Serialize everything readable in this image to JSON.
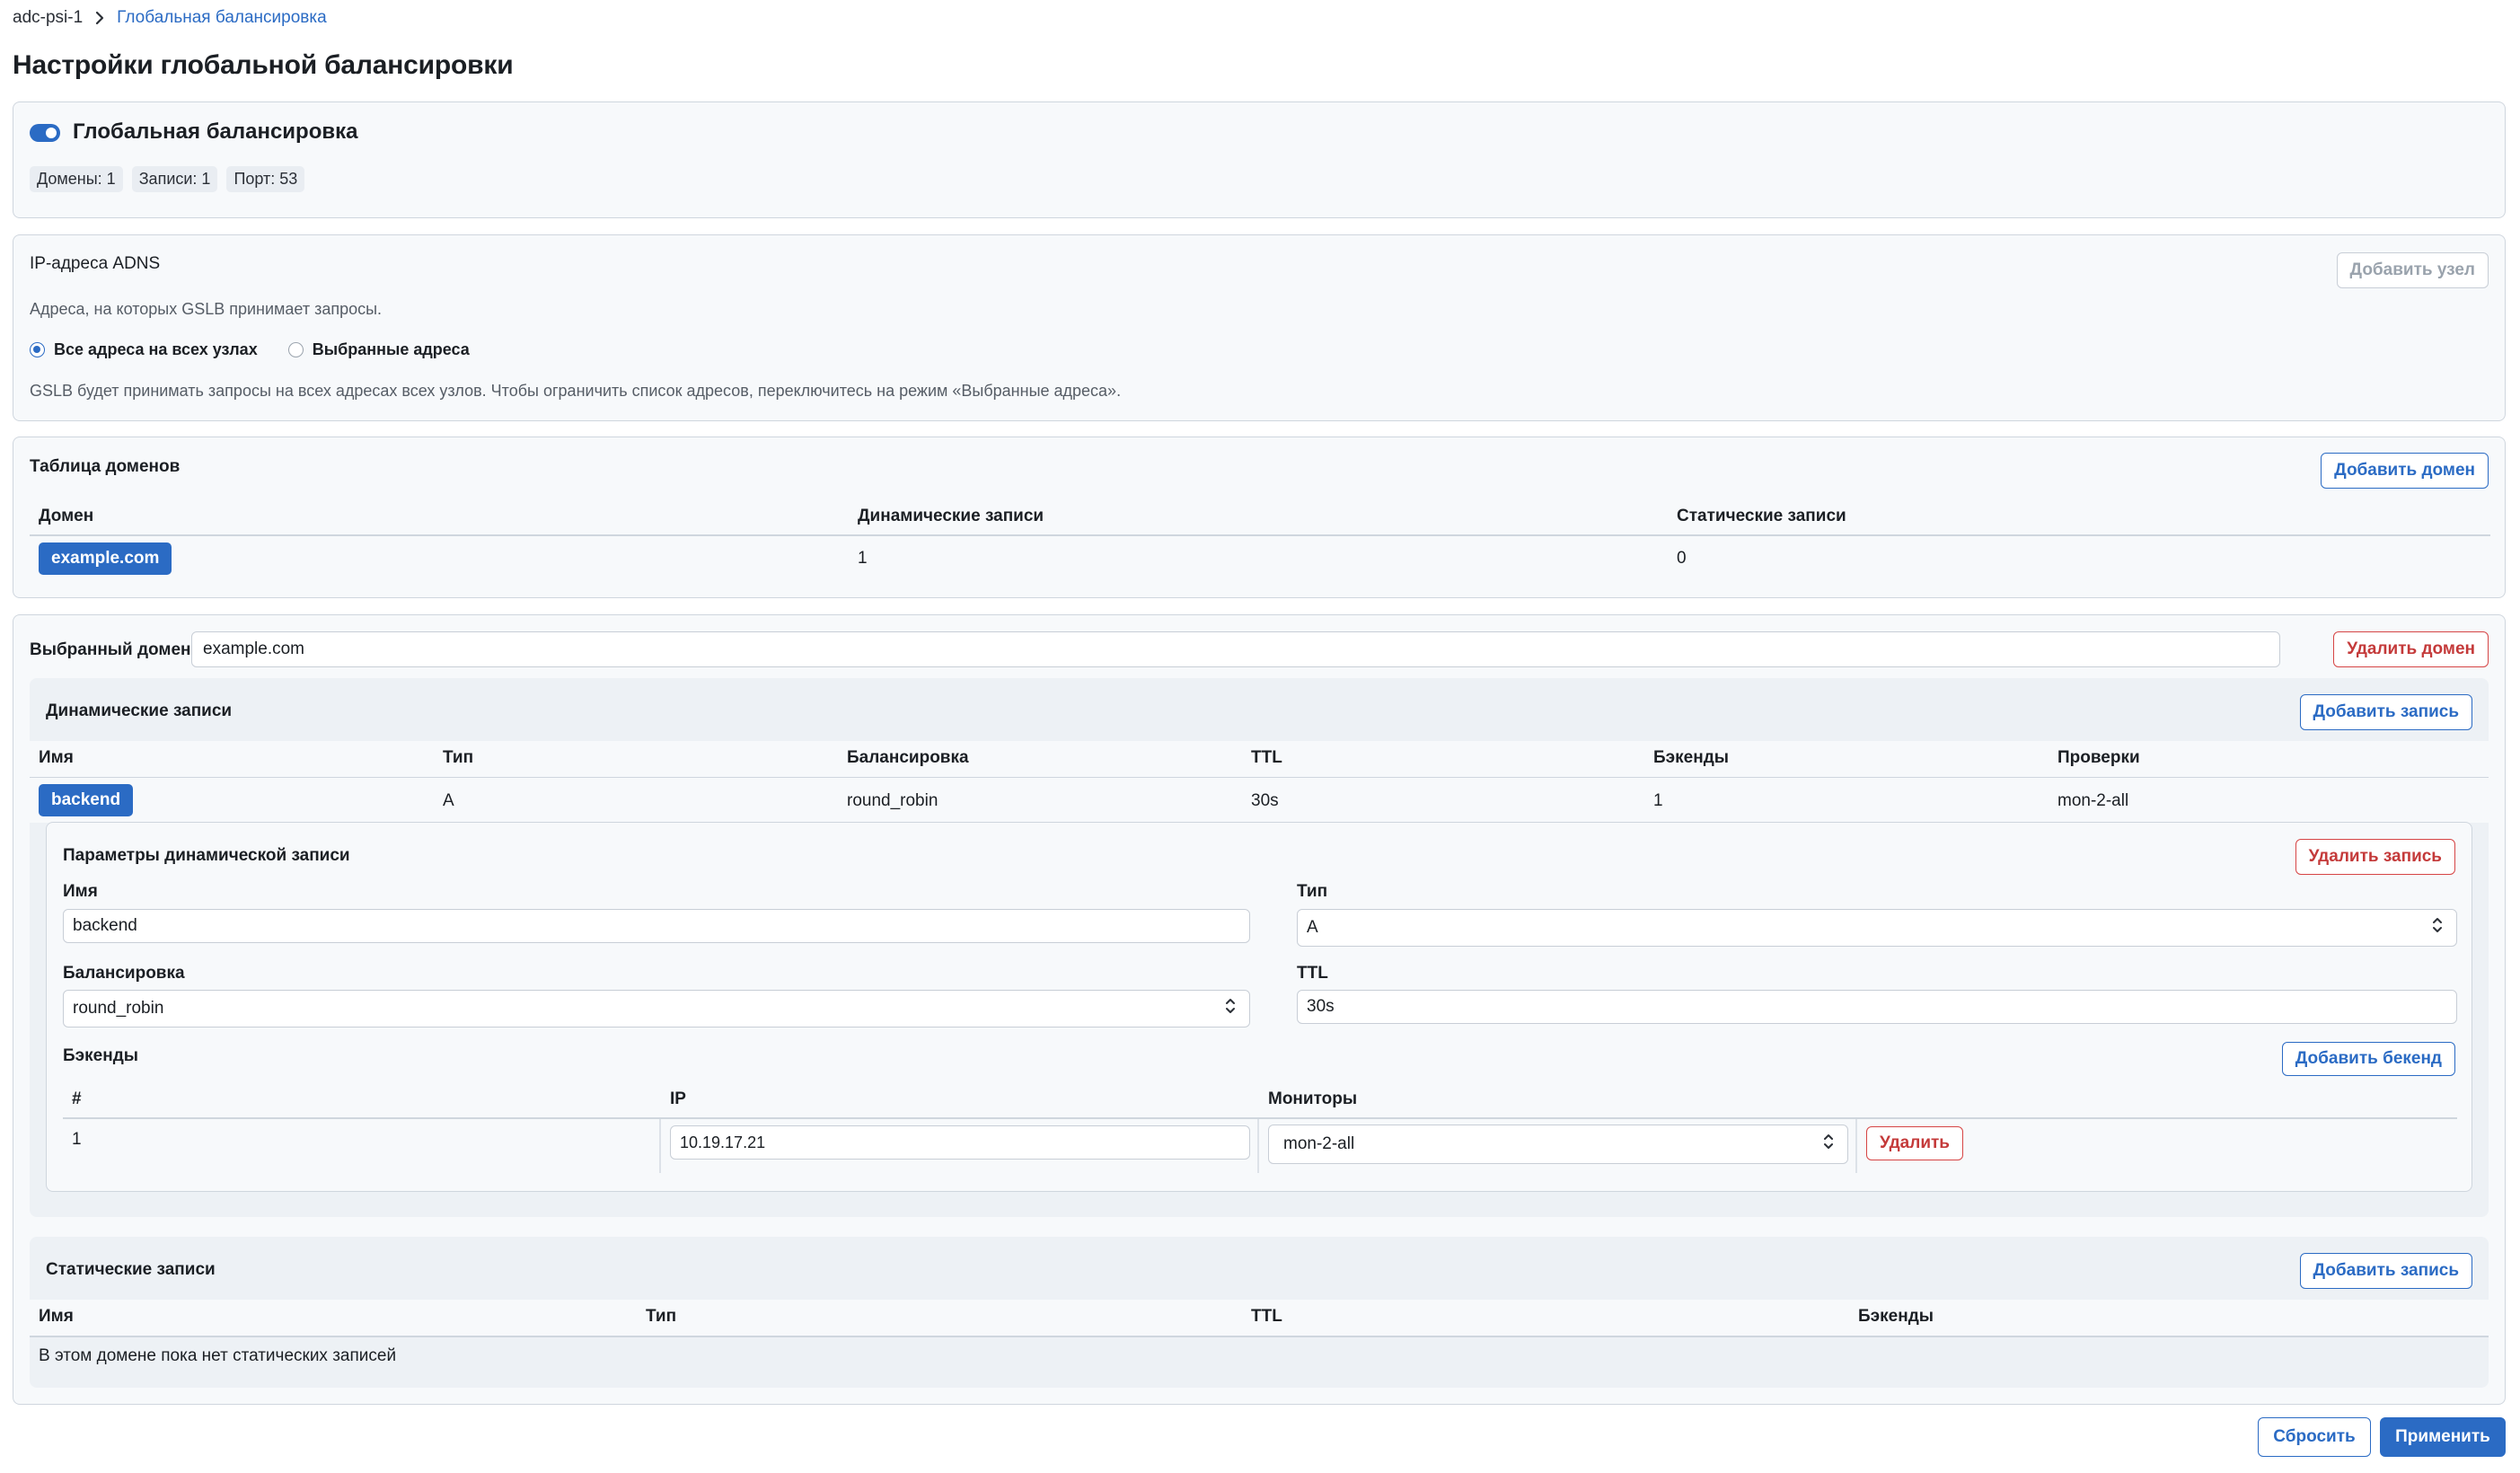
{
  "breadcrumb": {
    "root": "adc-psi-1",
    "current": "Глобальная балансировка"
  },
  "page_title": "Настройки глобальной балансировки",
  "global_balancing": {
    "title": "Глобальная балансировка",
    "enabled": true,
    "stats": [
      "Домены: 1",
      "Записи: 1",
      "Порт: 53"
    ]
  },
  "adns": {
    "title": "IP-адреса ADNS",
    "description": "Адреса, на которых GSLB принимает запросы.",
    "add_node_label": "Добавить узел",
    "options": [
      {
        "label": "Все адреса на всех узлах",
        "checked": true
      },
      {
        "label": "Выбранные адреса",
        "checked": false
      }
    ],
    "note": "GSLB будет принимать запросы на всех адресах всех узлов. Чтобы ограничить список адресов, переключитесь на режим «Выбранные адреса»."
  },
  "domains_table": {
    "title": "Таблица доменов",
    "add_label": "Добавить домен",
    "columns": [
      "Домен",
      "Динамические записи",
      "Статические записи"
    ],
    "rows": [
      {
        "domain": "example.com",
        "dynamic": "1",
        "static": "0"
      }
    ]
  },
  "selected_domain": {
    "label": "Выбранный домен",
    "value": "example.com",
    "delete_label": "Удалить домен"
  },
  "dynamic_records": {
    "title": "Динамические записи",
    "add_label": "Добавить запись",
    "columns": [
      "Имя",
      "Тип",
      "Балансировка",
      "TTL",
      "Бэкенды",
      "Проверки"
    ],
    "rows": [
      {
        "name": "backend",
        "type": "A",
        "balancing": "round_robin",
        "ttl": "30s",
        "backends": "1",
        "checks": "mon-2-all"
      }
    ]
  },
  "record_params": {
    "title": "Параметры динамической записи",
    "delete_label": "Удалить запись",
    "name_label": "Имя",
    "name_value": "backend",
    "type_label": "Тип",
    "type_value": "A",
    "balancing_label": "Балансировка",
    "balancing_value": "round_robin",
    "ttl_label": "TTL",
    "ttl_value": "30s",
    "backends_label": "Бэкенды",
    "add_backend_label": "Добавить бекенд",
    "backend_columns": [
      "#",
      "IP",
      "Мониторы"
    ],
    "backends": [
      {
        "index": "1",
        "ip": "10.19.17.21",
        "monitor": "mon-2-all",
        "delete_label": "Удалить"
      }
    ]
  },
  "static_records": {
    "title": "Статические записи",
    "add_label": "Добавить запись",
    "columns": [
      "Имя",
      "Тип",
      "TTL",
      "Бэкенды"
    ],
    "empty_text": "В этом домене пока нет статических записей"
  },
  "footer": {
    "reset_label": "Сбросить",
    "apply_label": "Применить"
  },
  "colors": {
    "accent": "#2b6bc4",
    "danger": "#c43a3a",
    "border": "#cfd6de",
    "panel": "#edf1f5"
  }
}
